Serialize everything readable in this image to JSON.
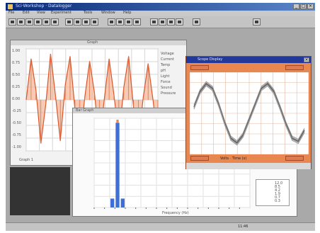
{
  "screen_colors": {
    "desktop": "#a9a9a9",
    "titlebar": "#0a2a78",
    "orange": "#e8874f",
    "signal": "#e0704a",
    "bar": "#3f6fd6"
  },
  "app": {
    "title": "Sci·Workshop · Datalogger",
    "status_text": "11:46",
    "menu": [
      "File",
      "Edit",
      "View",
      "Experiment",
      "Tools",
      "Window",
      "Help"
    ],
    "toolbar_icons": [
      "new-icon",
      "open-icon",
      "save-icon",
      "print-icon",
      "cut-icon",
      "copy-icon",
      "paste-icon",
      "start-icon",
      "stop-icon",
      "zoom-in-icon",
      "zoom-out-icon",
      "table-icon",
      "graph-icon",
      "meter-icon",
      "bar-graph-icon",
      "scope-icon",
      "fft-icon",
      "math-icon",
      "settings-icon",
      "help-icon"
    ]
  },
  "graph_window": {
    "title": "Graph",
    "y_ticks": [
      "1.00",
      "0.75",
      "0.50",
      "0.25",
      "0.00",
      "-0.25",
      "-0.50",
      "-0.75",
      "-1.00"
    ],
    "legend": [
      "Voltage",
      "Current",
      "Temp",
      "pH",
      "Light",
      "Force",
      "Sound",
      "Pressure"
    ],
    "status": "Graph 1"
  },
  "scope_window": {
    "title": "Scope Display",
    "footer_label": "Volts · Time (s)"
  },
  "bar_window": {
    "title": "Bar Graph",
    "x_label": "Frequency (Hz)",
    "side_values": [
      "12.0",
      "8.5",
      "4.2",
      "1.9",
      "0.7",
      "0.3"
    ]
  },
  "chart_data": [
    {
      "type": "line",
      "title": "",
      "xlabel": "",
      "ylabel": "",
      "ylim": [
        -1,
        1
      ],
      "grid": true,
      "series": [
        {
          "values": [
            0.0,
            0.85,
            0.2,
            -0.9,
            -0.1,
            0.95,
            0.1,
            -0.85,
            0.3,
            0.9,
            -0.2,
            -0.95,
            0.05,
            0.8,
            0.15,
            -0.9,
            0.0,
            0.85,
            0.1,
            -0.8,
            0.25,
            0.9,
            -0.15,
            -0.9,
            0.05,
            0.75,
            0.0,
            -0.85
          ]
        }
      ]
    },
    {
      "type": "line",
      "title": "",
      "xlabel": "",
      "ylabel": "",
      "grid": true,
      "series": [
        {
          "values": [
            0.2,
            0.7,
            0.95,
            0.8,
            0.3,
            -0.3,
            -0.8,
            -0.95,
            -0.7,
            -0.2,
            0.3,
            0.8,
            0.95,
            0.7,
            0.2,
            -0.35,
            -0.8,
            -0.9,
            -0.55
          ]
        }
      ]
    },
    {
      "type": "bar",
      "title": "",
      "grid": true,
      "categories": [
        "1",
        "2",
        "3",
        "4",
        "5",
        "6",
        "7",
        "8",
        "9",
        "10",
        "11",
        "12",
        "13",
        "14",
        "15",
        "16",
        "17",
        "18",
        "19",
        "20",
        "21",
        "22",
        "23",
        "24",
        "25",
        "26",
        "27",
        "28",
        "29",
        "30"
      ],
      "values": [
        0,
        0,
        0,
        0.1,
        0.95,
        0.1,
        0,
        0,
        0,
        0,
        0,
        0,
        0,
        0,
        0,
        0,
        0,
        0,
        0,
        0,
        0,
        0,
        0,
        0,
        0,
        0,
        0,
        0,
        0,
        0
      ]
    }
  ]
}
